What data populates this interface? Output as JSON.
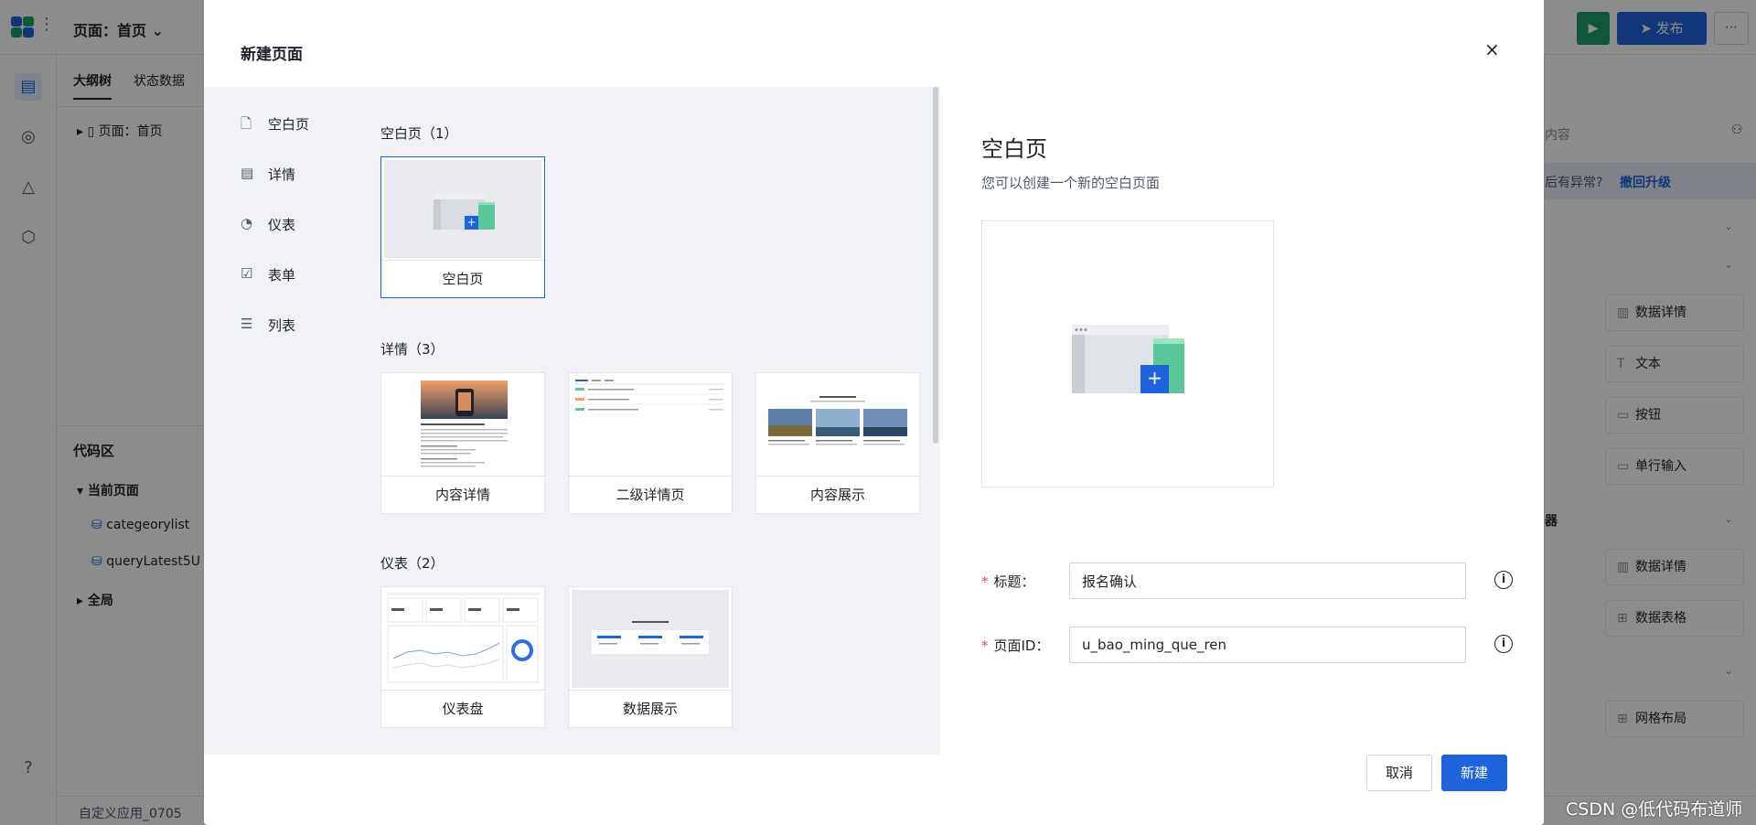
{
  "background": {
    "topbar": {
      "page_title": "页面：首页",
      "run_icon": "play-icon",
      "publish_label": "发布",
      "more_label": "⋯"
    },
    "left_panel": {
      "tabs": [
        "大纲树",
        "状态数据"
      ],
      "tree_root": "页面：首页",
      "code_area_title": "代码区",
      "current_page": "当前页面",
      "datasources": [
        "categeorylist",
        "queryLatest5U"
      ],
      "global": "全局"
    },
    "bottombar": {
      "app_name": "自定义应用_0705"
    },
    "right_panel": {
      "tab_label": "内容",
      "banner_text": "后有异常?",
      "banner_link": "撤回升级",
      "section_label": "器",
      "components": [
        "数据详情",
        "文本",
        "按钮",
        "单行输入",
        "数据详情",
        "数据表格",
        "网格布局"
      ]
    }
  },
  "modal": {
    "title": "新建页面",
    "close_label": "×",
    "categories": [
      {
        "label": "空白页",
        "icon": "file-icon"
      },
      {
        "label": "详情",
        "icon": "detail-icon"
      },
      {
        "label": "仪表",
        "icon": "gauge-icon"
      },
      {
        "label": "表单",
        "icon": "checkbox-icon"
      },
      {
        "label": "列表",
        "icon": "list-icon"
      }
    ],
    "groups": [
      {
        "title": "空白页（1）",
        "cards": [
          "空白页"
        ]
      },
      {
        "title": "详情（3）",
        "cards": [
          "内容详情",
          "二级详情页",
          "内容展示"
        ]
      },
      {
        "title": "仪表（2）",
        "cards": [
          "仪表盘",
          "数据展示"
        ]
      }
    ],
    "preview": {
      "title": "空白页",
      "description": "您可以创建一个新的空白页面"
    },
    "form": {
      "title_label": "标题：",
      "title_value": "报名确认",
      "id_label": "页面ID：",
      "id_value": "u_bao_ming_que_ren",
      "info_icon": "info-icon"
    },
    "cancel_label": "取消",
    "create_label": "新建"
  },
  "watermark": "CSDN @低代码布道师",
  "colors": {
    "primary": "#1f63dc",
    "run_green": "#1e9e6a",
    "required": "#e5484d"
  }
}
